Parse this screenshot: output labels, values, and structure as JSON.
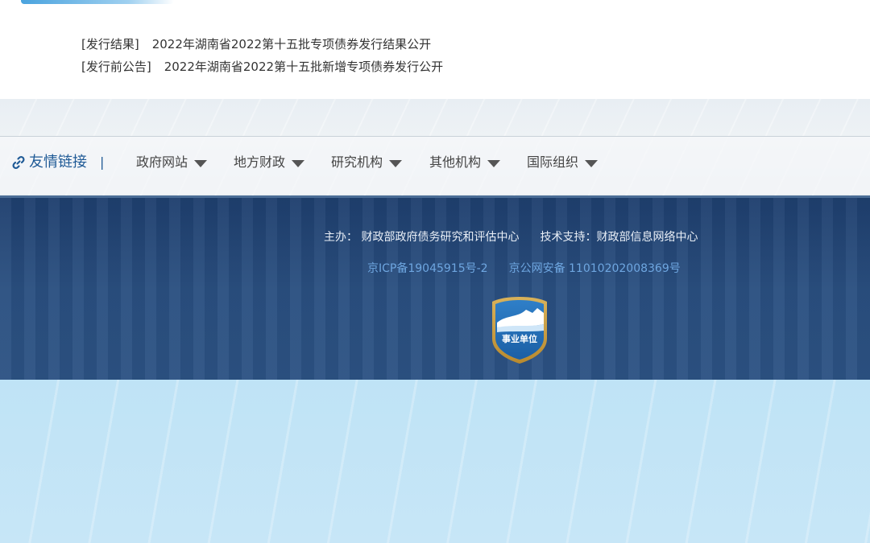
{
  "news": [
    {
      "tag": "[发行结果]",
      "title": "2022年湖南省2022第十五批专项债券发行结果公开"
    },
    {
      "tag": "[发行前公告]",
      "title": "2022年湖南省2022第十五批新增专项债券发行公开"
    }
  ],
  "links": {
    "title": "友情链接",
    "separator": "|",
    "items": [
      {
        "label": "政府网站"
      },
      {
        "label": "地方财政"
      },
      {
        "label": "研究机构"
      },
      {
        "label": "其他机构"
      },
      {
        "label": "国际组织"
      }
    ]
  },
  "footer": {
    "sponsor": "主办： 财政部政府债务研究和评估中心",
    "tech_support": "技术支持：财政部信息网络中心",
    "icp": "京ICP备19045915号-2",
    "police": "京公网安备 11010202008369号",
    "badge_text": "事业单位"
  },
  "colors": {
    "footer_bg": "#1e3f6e",
    "link_accent": "#1f5a96",
    "icp_link": "#6ea6e0"
  }
}
